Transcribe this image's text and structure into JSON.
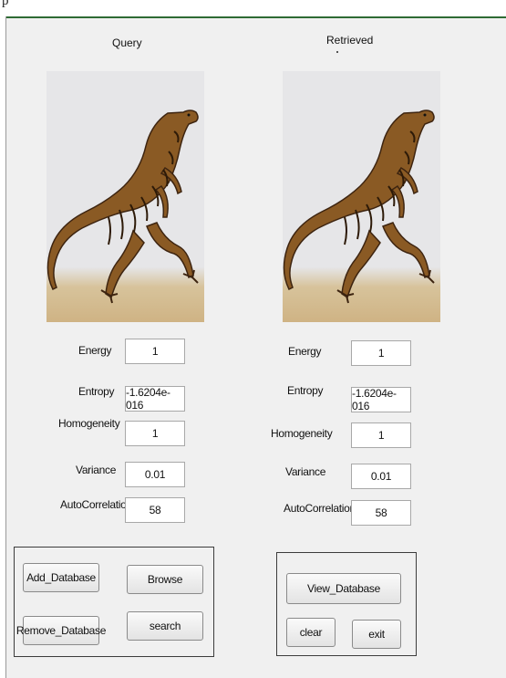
{
  "window": {
    "title_fragment": "p"
  },
  "query": {
    "caption": "Query",
    "image_icon": "dinosaur-image"
  },
  "retrieved": {
    "caption": "Retrieved",
    "image_icon": "dinosaur-image"
  },
  "features": {
    "labels": [
      "Energy",
      "Entropy",
      "Homogeneity",
      "Variance",
      "AutoCorrelation"
    ],
    "query_values": [
      "1",
      "-1.6204e-016",
      "1",
      "0.01",
      "58"
    ],
    "retrieved_values": [
      "1",
      "-1.6204e-016",
      "1",
      "0.01",
      "58"
    ]
  },
  "buttons": {
    "add_database": "Add_Database",
    "browse": "Browse",
    "remove_database": "Remove_Database",
    "search": "search",
    "view_database": "View_Database",
    "clear": "clear",
    "exit": "exit"
  },
  "colors": {
    "panel_bg": "#f0f0f0",
    "title_border": "#2e6b34"
  }
}
